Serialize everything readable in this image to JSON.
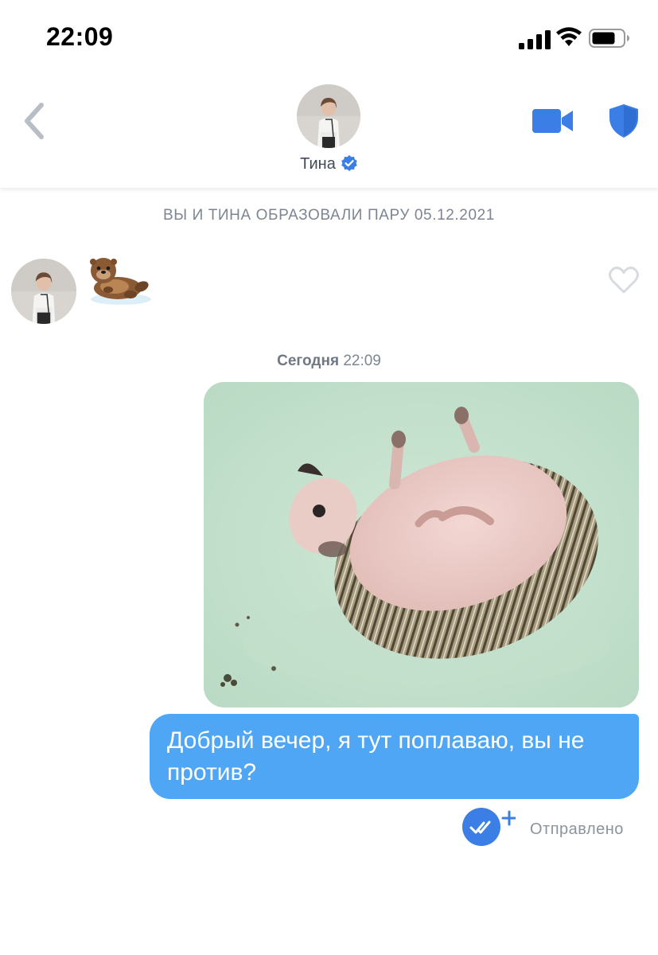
{
  "status_bar": {
    "time": "22:09",
    "icons": [
      "cellular-signal-icon",
      "wifi-icon",
      "battery-icon"
    ]
  },
  "header": {
    "back_icon": "chevron-left-icon",
    "contact_name": "Тина",
    "verified_icon": "verified-badge-icon",
    "actions": [
      "video-camera-icon",
      "shield-icon"
    ]
  },
  "chat": {
    "match_notice": "ВЫ И ТИНА ОБРАЗОВАЛИ ПАРУ 05.12.2021",
    "incoming": {
      "sticker": "otter-sticker",
      "like_icon": "heart-outline-icon"
    },
    "date_label": "Сегодня",
    "date_time": "22:09",
    "outgoing_image": "floating-hedgehog-gif",
    "outgoing_text": "Добрый вечер, я тут поплаваю, вы не против?",
    "read_receipt_icon": "double-check-plus-icon",
    "status": "Отправлено"
  },
  "colors": {
    "accent_blue": "#4ea6f5",
    "icon_blue": "#3b7ee5",
    "muted_text": "#7c8591",
    "heart_outline": "#d7dbe0"
  }
}
